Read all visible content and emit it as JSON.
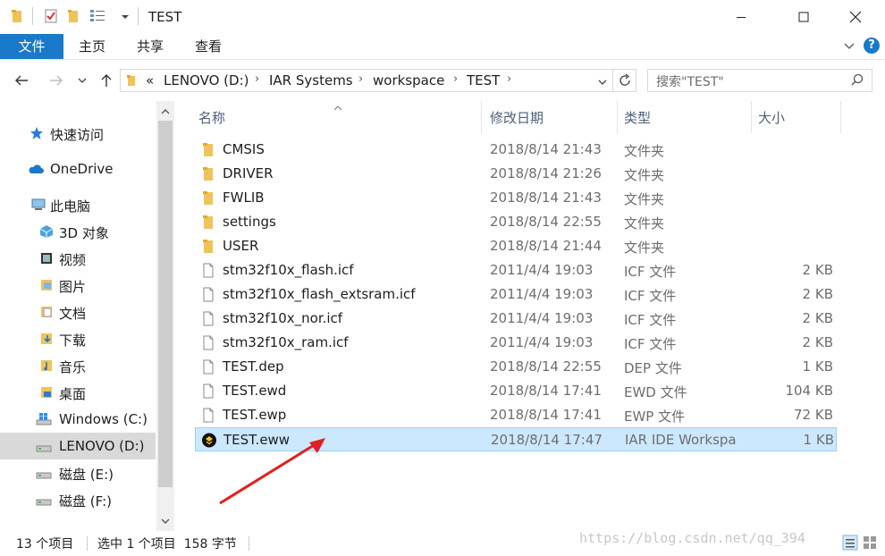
{
  "titlebar": {
    "title": "TEST",
    "quick_access": [
      "folder-icon",
      "properties-check-icon",
      "new-folder-icon",
      "view-icon",
      "dropdown-arrow-icon"
    ]
  },
  "ribbon": {
    "tabs": [
      "文件",
      "主页",
      "共享",
      "查看"
    ]
  },
  "address": {
    "overflow": "«",
    "crumbs": [
      "LENOVO (D:)",
      "IAR Systems",
      "workspace",
      "TEST"
    ]
  },
  "search": {
    "placeholder": "搜索\"TEST\""
  },
  "sidebar": {
    "quick_access": "快速访问",
    "onedrive": "OneDrive",
    "this_pc": "此电脑",
    "items": [
      "3D 对象",
      "视频",
      "图片",
      "文档",
      "下载",
      "音乐",
      "桌面",
      "Windows (C:)",
      "LENOVO (D:)",
      "磁盘 (E:)",
      "磁盘 (F:)"
    ],
    "selected": "LENOVO (D:)"
  },
  "columns": {
    "name": "名称",
    "date": "修改日期",
    "type": "类型",
    "size": "大小"
  },
  "files": [
    {
      "name": "CMSIS",
      "date": "2018/8/14 21:43",
      "type": "文件夹",
      "size": "",
      "kind": "folder"
    },
    {
      "name": "DRIVER",
      "date": "2018/8/14 21:26",
      "type": "文件夹",
      "size": "",
      "kind": "folder"
    },
    {
      "name": "FWLIB",
      "date": "2018/8/14 21:43",
      "type": "文件夹",
      "size": "",
      "kind": "folder"
    },
    {
      "name": "settings",
      "date": "2018/8/14 22:55",
      "type": "文件夹",
      "size": "",
      "kind": "folder"
    },
    {
      "name": "USER",
      "date": "2018/8/14 21:44",
      "type": "文件夹",
      "size": "",
      "kind": "folder"
    },
    {
      "name": "stm32f10x_flash.icf",
      "date": "2011/4/4 19:03",
      "type": "ICF 文件",
      "size": "2 KB",
      "kind": "file"
    },
    {
      "name": "stm32f10x_flash_extsram.icf",
      "date": "2011/4/4 19:03",
      "type": "ICF 文件",
      "size": "2 KB",
      "kind": "file"
    },
    {
      "name": "stm32f10x_nor.icf",
      "date": "2011/4/4 19:03",
      "type": "ICF 文件",
      "size": "2 KB",
      "kind": "file"
    },
    {
      "name": "stm32f10x_ram.icf",
      "date": "2011/4/4 19:03",
      "type": "ICF 文件",
      "size": "2 KB",
      "kind": "file"
    },
    {
      "name": "TEST.dep",
      "date": "2018/8/14 22:55",
      "type": "DEP 文件",
      "size": "1 KB",
      "kind": "file"
    },
    {
      "name": "TEST.ewd",
      "date": "2018/8/14 17:41",
      "type": "EWD 文件",
      "size": "104 KB",
      "kind": "file"
    },
    {
      "name": "TEST.ewp",
      "date": "2018/8/14 17:41",
      "type": "EWP 文件",
      "size": "72 KB",
      "kind": "file"
    },
    {
      "name": "TEST.eww",
      "date": "2018/8/14 17:47",
      "type": "IAR IDE Workspa",
      "size": "1 KB",
      "kind": "iar"
    }
  ],
  "selected_file": "TEST.eww",
  "status": {
    "count": "13 个项目",
    "selection": "选中 1 个项目  158 字节"
  },
  "watermark": "https://blog.csdn.net/qq_394",
  "colors": {
    "accent": "#1979ca",
    "selection": "#cce8ff",
    "folder": "#f0c35a",
    "annotation_arrow": "#e02020"
  }
}
